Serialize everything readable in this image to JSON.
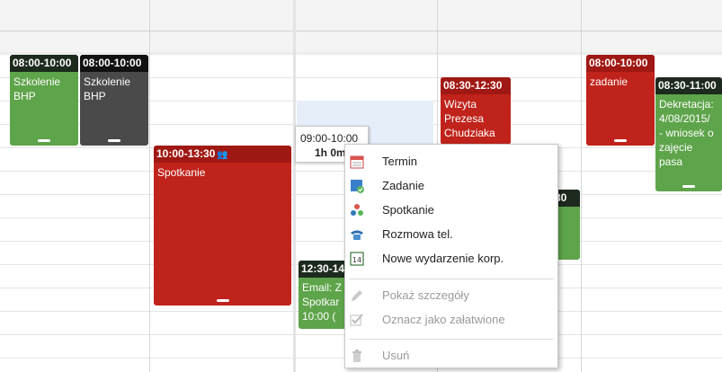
{
  "events": [
    {
      "id": "szkolenie-1",
      "time": "08:00-10:00",
      "body": "Szkolenie\nBHP",
      "color": "#5ea44a"
    },
    {
      "id": "szkolenie-2",
      "time": "08:00-10:00",
      "body": "Szkolenie\nBHP",
      "color": "#4a4a4a"
    },
    {
      "id": "spotkanie",
      "time": "10:00-13:30",
      "body": "Spotkanie",
      "color": "#c0231b"
    },
    {
      "id": "wizyta",
      "time": "08:30-12:30",
      "body": "Wizyta\nPrezesa\nChudziaka",
      "color": "#c0231b"
    },
    {
      "id": "email",
      "time": "12:30-14",
      "body": "Email: Z\nSpotkar\n10:00 (",
      "color": "#5ea44a"
    },
    {
      "id": "partial",
      "time": "30",
      "body": "",
      "color": "#5ea44a"
    },
    {
      "id": "zadanie",
      "time": "08:00-10:00",
      "body": "zadanie",
      "color": "#c0231b"
    },
    {
      "id": "dekretacja",
      "time": "08:30-11:00",
      "body": "Dekretacja:\n4/08/2015/\n- wniosek o\nzajęcie\npasa",
      "color": "#5ea44a"
    }
  ],
  "selection_tooltip": {
    "range": "09:00-10:00",
    "duration": "1h 0m"
  },
  "context_menu": {
    "items": [
      {
        "label": "Termin",
        "icon": "calendar-icon",
        "enabled": true
      },
      {
        "label": "Zadanie",
        "icon": "task-icon",
        "enabled": true
      },
      {
        "label": "Spotkanie",
        "icon": "meeting-icon",
        "enabled": true
      },
      {
        "label": "Rozmowa tel.",
        "icon": "phone-icon",
        "enabled": true
      },
      {
        "label": "Nowe wydarzenie korp.",
        "icon": "corporate-event-icon",
        "enabled": true
      },
      {
        "label": "Pokaż szczegóły",
        "icon": "pencil-icon",
        "enabled": false
      },
      {
        "label": "Oznacz jako załatwione",
        "icon": "check-icon",
        "enabled": false
      },
      {
        "label": "Usuń",
        "icon": "trash-icon",
        "enabled": false
      }
    ],
    "corporate_icon_text": "14"
  },
  "colors": {
    "green": "#5ea44a",
    "red": "#c0231b",
    "dark": "#4a4a4a",
    "selection": "#e6eefa"
  }
}
